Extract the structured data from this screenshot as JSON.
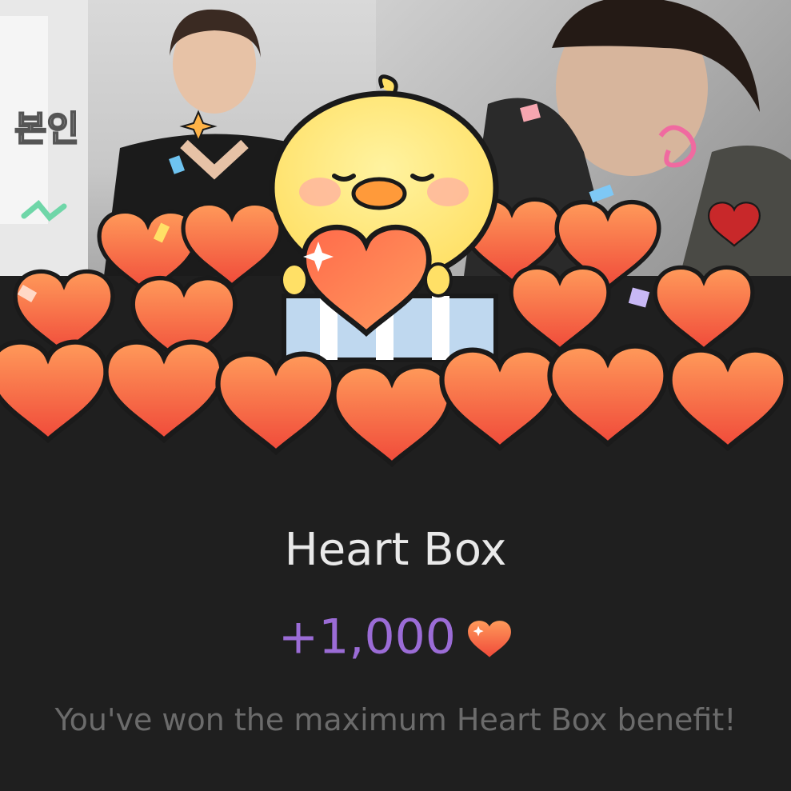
{
  "photo": {
    "caption": "본인"
  },
  "dialog": {
    "title": "Heart Box",
    "reward_amount": "+1,000",
    "reward_icon": "heart-icon",
    "message": "You've won the maximum Heart Box benefit!"
  },
  "colors": {
    "background": "#1f1f1f",
    "title": "#e9e9e9",
    "reward": "#9b6cd6",
    "message": "#6b6b6b",
    "heart_top": "#ff9a5a",
    "heart_bottom": "#f04a3a"
  }
}
